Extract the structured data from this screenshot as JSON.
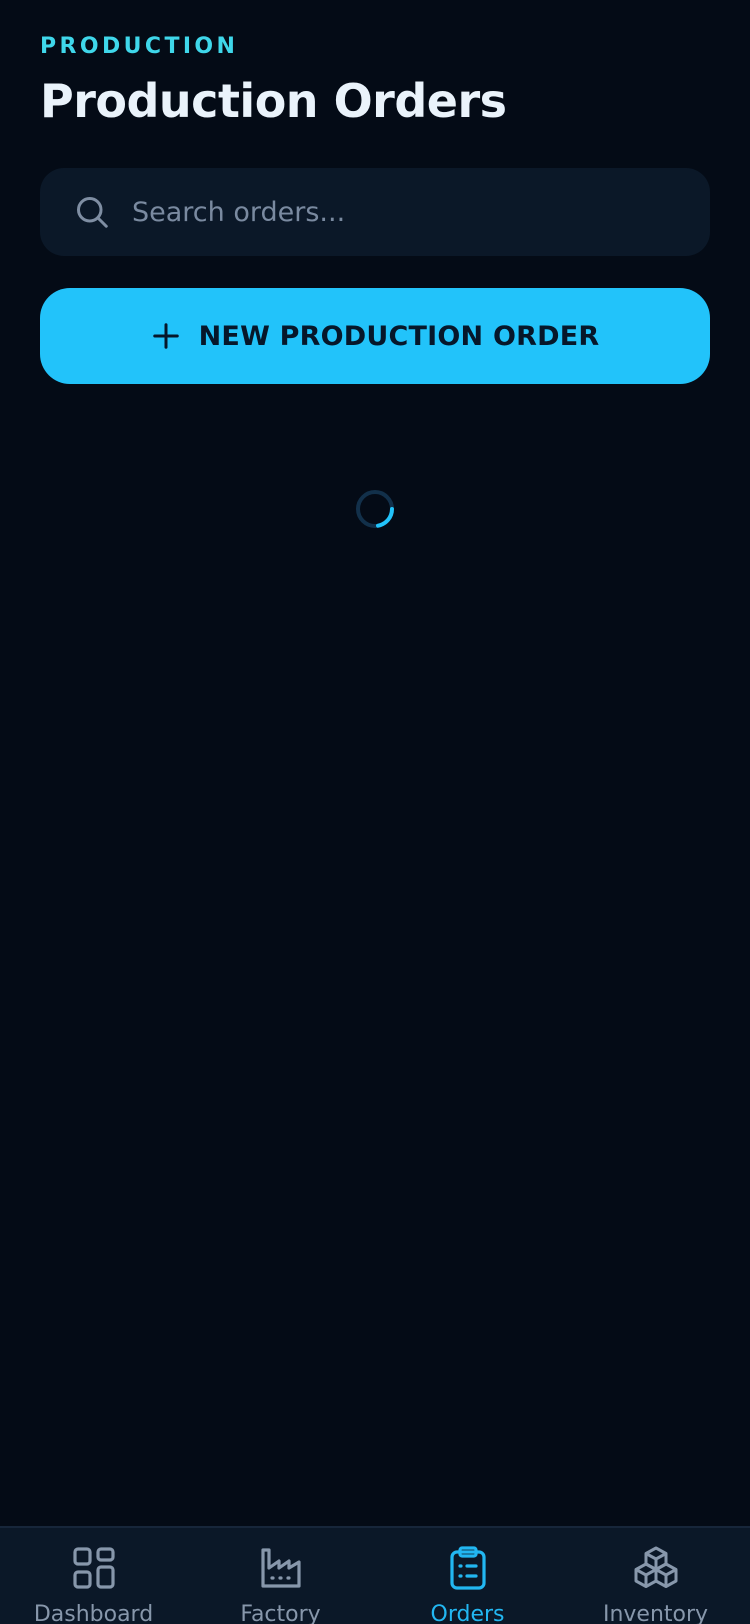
{
  "header": {
    "eyebrow": "PRODUCTION",
    "title": "Production Orders"
  },
  "search": {
    "placeholder": "Search orders...",
    "value": "",
    "icon": "search-icon"
  },
  "new_order_button": {
    "label": "NEW PRODUCTION ORDER",
    "icon": "plus-icon"
  },
  "loading": {
    "icon": "loading-spinner"
  },
  "tabbar": {
    "active": "orders",
    "items": [
      {
        "label": "Dashboard",
        "icon": "dashboard-icon"
      },
      {
        "label": "Factory",
        "icon": "factory-icon"
      },
      {
        "label": "Orders",
        "icon": "clipboard-list-icon"
      },
      {
        "label": "Inventory",
        "icon": "boxes-icon"
      }
    ]
  },
  "colors": {
    "background": "#040b16",
    "accent": "#22c3fa",
    "eyebrow": "#3fd7ea",
    "surface": "#0b1828",
    "muted": "#8797ab"
  }
}
